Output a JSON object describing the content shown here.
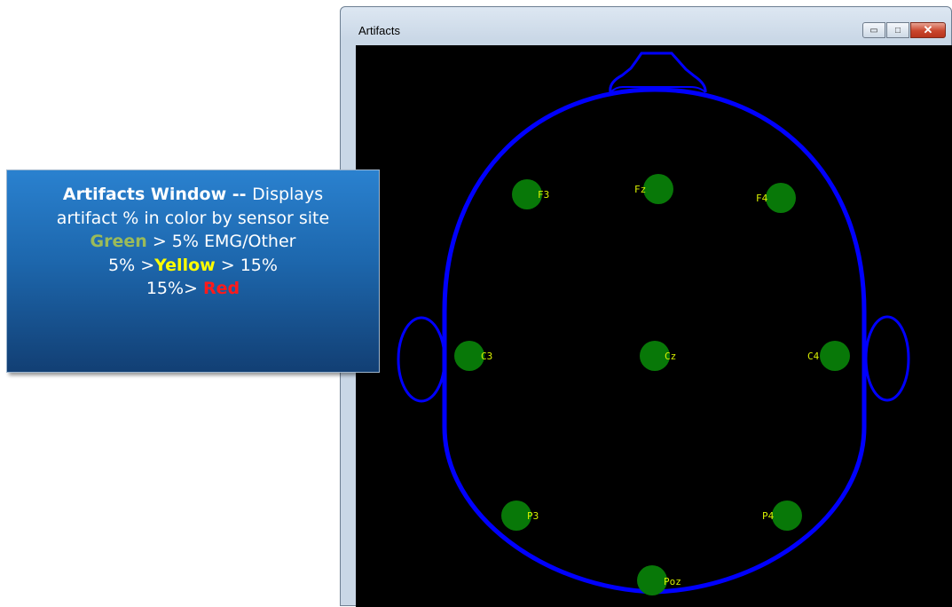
{
  "window": {
    "title": "Artifacts",
    "buttons": {
      "minimize": "▭",
      "maximize": "□",
      "close": "✕"
    }
  },
  "callout": {
    "title": "Artifacts Window",
    "separator": " -- ",
    "line1_rest": "Displays",
    "line2": "artifact % in color by sensor site",
    "line3_colored": "Green",
    "line3_rest": " > 5% EMG/Other",
    "line4_prefix": "5% >",
    "line4_colored": "Yellow",
    "line4_rest": " > 15%",
    "line5_prefix": "15%> ",
    "line5_colored": "Red"
  },
  "sensors": [
    {
      "label": "F3",
      "status": "green"
    },
    {
      "label": "Fz",
      "status": "green"
    },
    {
      "label": "F4",
      "status": "green"
    },
    {
      "label": "C3",
      "status": "green"
    },
    {
      "label": "Cz",
      "status": "green"
    },
    {
      "label": "C4",
      "status": "green"
    },
    {
      "label": "P3",
      "status": "green"
    },
    {
      "label": "P4",
      "status": "green"
    },
    {
      "label": "Poz",
      "status": "green"
    }
  ],
  "colors": {
    "head_outline": "#0000ff",
    "canvas_bg": "#000000",
    "sensor_green": "#087808",
    "label": "#d8f000"
  }
}
